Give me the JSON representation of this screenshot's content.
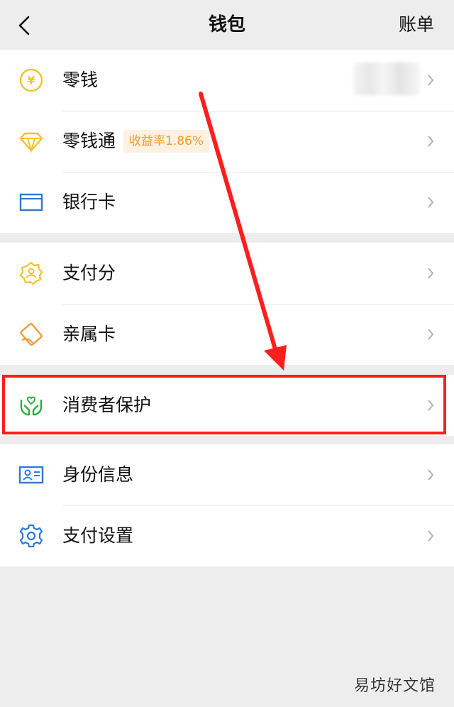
{
  "nav": {
    "title": "钱包",
    "action": "账单"
  },
  "groups": [
    {
      "items": [
        {
          "label": "零钱",
          "icon": "yen-coin-icon",
          "value": "blurred"
        },
        {
          "label": "零钱通",
          "icon": "diamond-icon",
          "badge": "收益率1.86%"
        },
        {
          "label": "银行卡",
          "icon": "bank-card-icon"
        }
      ]
    },
    {
      "items": [
        {
          "label": "支付分",
          "icon": "pay-score-badge-icon"
        },
        {
          "label": "亲属卡",
          "icon": "family-card-icon"
        }
      ]
    },
    {
      "items": [
        {
          "label": "消费者保护",
          "icon": "protection-hands-icon",
          "highlighted": true
        }
      ]
    },
    {
      "items": [
        {
          "label": "身份信息",
          "icon": "id-card-icon"
        },
        {
          "label": "支付设置",
          "icon": "settings-gear-icon"
        }
      ]
    }
  ],
  "colors": {
    "background": "#ededed",
    "icon_yellow": "#f4c22b",
    "icon_blue": "#2f79d4",
    "icon_orange": "#f29a3c",
    "icon_green": "#2cad3e",
    "badge_text": "#f19a35",
    "annotation_red": "#ff1e1e"
  },
  "watermark": "易坊好文馆"
}
